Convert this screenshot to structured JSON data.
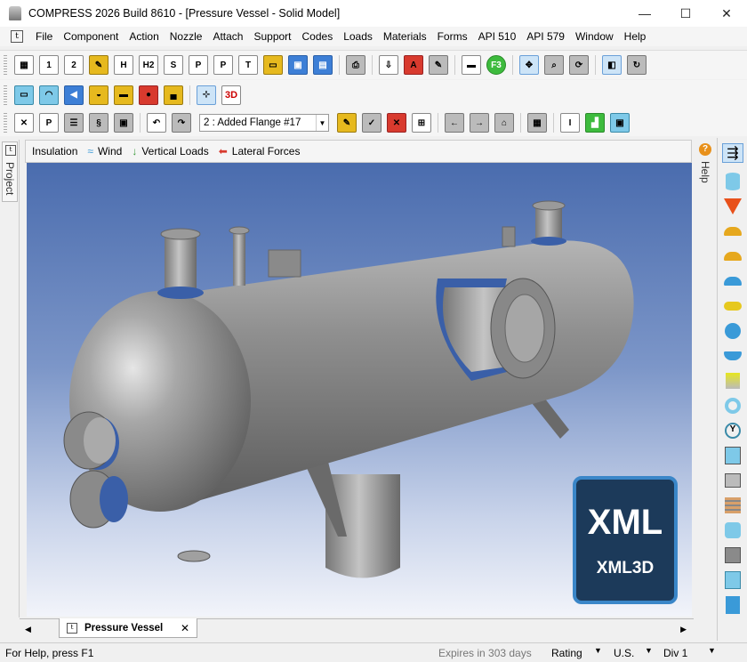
{
  "window": {
    "title": "COMPRESS 2026 Build 8610 - [Pressure Vessel - Solid Model]",
    "minimize": "—",
    "maximize": "☐",
    "close": "✕"
  },
  "menu": {
    "items": [
      "File",
      "Component",
      "Action",
      "Nozzle",
      "Attach",
      "Support",
      "Codes",
      "Loads",
      "Materials",
      "Forms",
      "API 510",
      "API 579",
      "Window",
      "Help"
    ]
  },
  "toolbar1": {
    "buttons": [
      "1",
      "2",
      "H",
      "H2",
      "S",
      "P",
      "P",
      "T"
    ],
    "f3_label": "F3"
  },
  "toolbar2": {
    "view_3d_label": "3D"
  },
  "toolbar3": {
    "component_select": "2 : Added Flange #17"
  },
  "load_tabs": {
    "insulation": "Insulation",
    "wind": "Wind",
    "vertical": "Vertical Loads",
    "lateral": "Lateral Forces"
  },
  "left_panel": {
    "project_label": "Project"
  },
  "help_panel": {
    "label": "Help",
    "icon": "?"
  },
  "badge": {
    "big": "XML",
    "small": "XML3D"
  },
  "doc_tab": {
    "label": "Pressure Vessel",
    "close": "✕"
  },
  "status": {
    "help": "For Help, press F1",
    "expires": "Expires in 303 days",
    "rating": "Rating",
    "units": "U.S.",
    "div": "Div 1"
  },
  "colors": {
    "viewport_top": "#4a6cae",
    "viewport_bottom": "#f2f4fa",
    "vessel": "#8a8a8a",
    "gasket": "#3a5fa8",
    "badge_bg": "#1c3a5a"
  }
}
